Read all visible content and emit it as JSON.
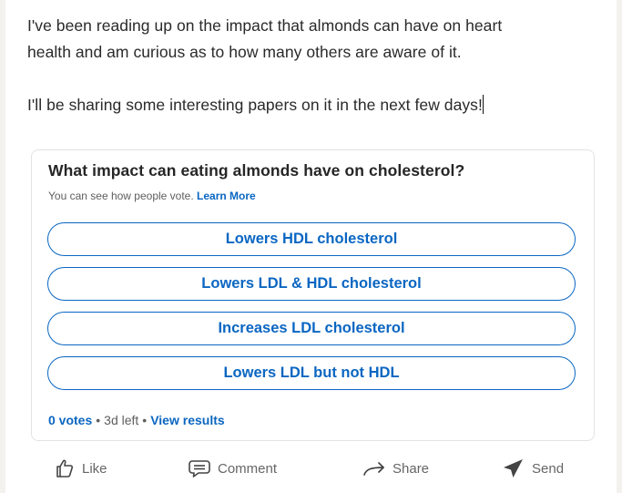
{
  "post": {
    "paragraph1_line1": "I've been reading up on the impact that almonds can have on heart",
    "paragraph1_line2": "health and am curious as to how many others are aware of it.",
    "paragraph2": "I'll be sharing some interesting papers on it in the next few days!"
  },
  "poll": {
    "question": "What impact can eating almonds have on cholesterol?",
    "visibility_note": "You can see how people vote.",
    "learn_more": "Learn More",
    "options": [
      {
        "label": "Lowers HDL cholesterol"
      },
      {
        "label": "Lowers LDL & HDL cholesterol"
      },
      {
        "label": "Increases LDL cholesterol"
      },
      {
        "label": "Lowers LDL but not HDL"
      }
    ],
    "votes": "0 votes",
    "separator": "•",
    "time_left": "3d left",
    "view_results": "View results"
  },
  "actions": {
    "like": {
      "label": "Like",
      "icon": "thumbs-up-icon"
    },
    "comment": {
      "label": "Comment",
      "icon": "comment-icon"
    },
    "share": {
      "label": "Share",
      "icon": "share-arrow-icon"
    },
    "send": {
      "label": "Send",
      "icon": "send-icon"
    }
  },
  "colors": {
    "accent": "#0a66c2",
    "text": "#2a2a2a",
    "muted": "#666666",
    "background": "#f3f2ef",
    "card": "#ffffff"
  }
}
